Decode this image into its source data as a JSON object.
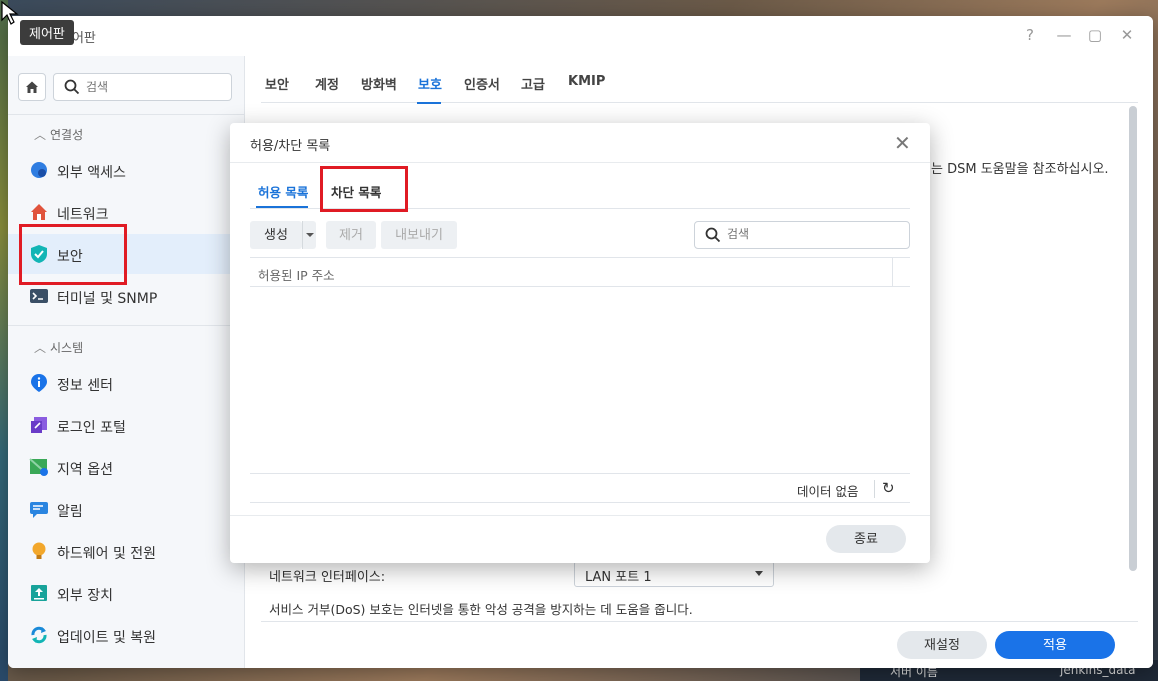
{
  "tooltip": "제어판",
  "window": {
    "title": "제어판",
    "controls": {
      "help": "?",
      "minimize": "—",
      "maximize": "▢",
      "close": "✕"
    }
  },
  "sidebar": {
    "search_placeholder": "검색",
    "sections": [
      {
        "label": "연결성",
        "items": [
          {
            "label": "외부 액세스",
            "icon": "globe-icon",
            "color": "#2f7de1"
          },
          {
            "label": "네트워크",
            "icon": "house-icon",
            "color": "#e0533c"
          },
          {
            "label": "보안",
            "icon": "shield-icon",
            "color": "#12b5b5",
            "active": true
          },
          {
            "label": "터미널 및 SNMP",
            "icon": "terminal-icon",
            "color": "#3a4f66"
          }
        ]
      },
      {
        "label": "시스템",
        "items": [
          {
            "label": "정보 센터",
            "icon": "info-icon",
            "color": "#1a73e8"
          },
          {
            "label": "로그인 포털",
            "icon": "portal-icon",
            "color": "#6a3cc8"
          },
          {
            "label": "지역 옵션",
            "icon": "map-icon",
            "color": "#3aa857"
          },
          {
            "label": "알림",
            "icon": "chat-icon",
            "color": "#2a85e0"
          },
          {
            "label": "하드웨어 및 전원",
            "icon": "bulb-icon",
            "color": "#f2a72b"
          },
          {
            "label": "외부 장치",
            "icon": "upload-icon",
            "color": "#18a39a"
          },
          {
            "label": "업데이트 및 복원",
            "icon": "refresh-icon",
            "color": "#1a8ad8"
          }
        ]
      }
    ]
  },
  "main": {
    "tabs": [
      {
        "label": "보안"
      },
      {
        "label": "계정"
      },
      {
        "label": "방화벽"
      },
      {
        "label": "보호",
        "active": true
      },
      {
        "label": "인증서"
      },
      {
        "label": "고급"
      },
      {
        "label": "KMIP"
      }
    ],
    "help_fragment": "는 DSM 도움말을 참조하십시오.",
    "network_interface_label": "네트워크 인터페이스:",
    "network_interface_value": "LAN 포트 1",
    "dos_text": "서비스 거부(DoS) 보호는 인터넷을 통한 악성 공격을 방지하는 데 도움을 줍니다.",
    "reset_label": "재설정",
    "apply_label": "적용"
  },
  "modal": {
    "title": "허용/차단 목록",
    "tabs": [
      {
        "label": "허용 목록",
        "active": true
      },
      {
        "label": "차단 목록"
      }
    ],
    "buttons": {
      "create": "생성",
      "remove": "제거",
      "export": "내보내기"
    },
    "search_placeholder": "검색",
    "column_header": "허용된 IP 주소",
    "no_data": "데이터 없음",
    "close_label": "종료"
  },
  "bottom_strip": {
    "left": "서버 이름",
    "right": "jenkins_data"
  },
  "colors": {
    "accent": "#1a73e8",
    "highlight": "#e01b24"
  }
}
